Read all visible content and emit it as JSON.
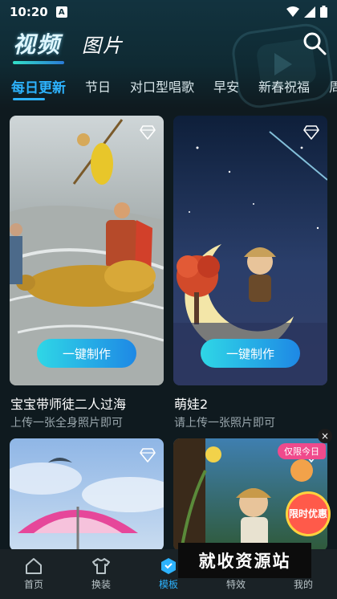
{
  "status_bar": {
    "time": "10:20",
    "notification_letter": "A"
  },
  "header": {
    "title_active": "视频",
    "title_inactive": "图片"
  },
  "tabs": [
    {
      "label": "每日更新",
      "active": true
    },
    {
      "label": "节日",
      "active": false
    },
    {
      "label": "对口型唱歌",
      "active": false
    },
    {
      "label": "早安",
      "active": false
    },
    {
      "label": "新春祝福",
      "active": false
    },
    {
      "label": "周",
      "active": false
    }
  ],
  "cards": [
    {
      "title": "宝宝带师徒二人过海",
      "subtitle": "上传一张全身照片即可",
      "button": "一键制作",
      "icon": "diamond-icon"
    },
    {
      "title": "萌娃2",
      "subtitle": "请上传一张照片即可",
      "button": "一键制作",
      "icon": "diamond-icon"
    },
    {
      "title": "",
      "subtitle": "",
      "button": "",
      "icon": "diamond-icon"
    },
    {
      "title": "",
      "subtitle": "",
      "button": "",
      "icon": "diamond-icon"
    }
  ],
  "promo": {
    "label": "仅限今日",
    "badge": "限时优惠",
    "close": "×"
  },
  "bottom_nav": [
    {
      "label": "首页",
      "icon": "home-icon",
      "active": false
    },
    {
      "label": "换装",
      "icon": "shirt-icon",
      "active": false
    },
    {
      "label": "模板",
      "icon": "template-icon",
      "active": true
    },
    {
      "label": "特效",
      "icon": "effects-icon",
      "active": false
    },
    {
      "label": "我的",
      "icon": "profile-icon",
      "active": false
    }
  ],
  "watermark": "就收资源站",
  "colors": {
    "accent": "#2db3ff",
    "button_start": "#2fd7e6",
    "button_end": "#1e88e5",
    "background": "#0f1a1f"
  }
}
